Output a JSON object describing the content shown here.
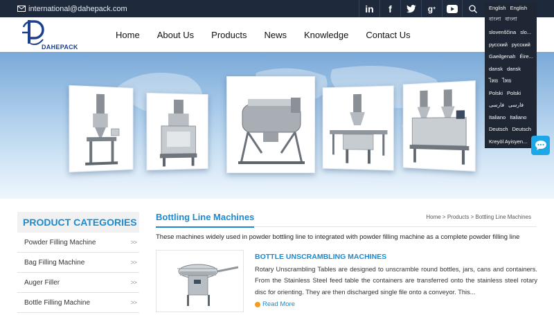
{
  "topbar": {
    "email": "international@dahepack.com",
    "social": [
      "linkedin-icon",
      "facebook-icon",
      "twitter-icon",
      "google-plus-icon",
      "youtube-icon"
    ]
  },
  "logo": {
    "text": "DAHEPACK"
  },
  "nav": {
    "items": [
      "Home",
      "About Us",
      "Products",
      "News",
      "Knowledge",
      "Contact Us"
    ]
  },
  "languages": [
    {
      "native": "English",
      "label": "English"
    },
    {
      "native": "বাংলা",
      "label": "বাংলা"
    },
    {
      "native": "slovenščina",
      "label": "slo..."
    },
    {
      "native": "русский",
      "label": "русский"
    },
    {
      "native": "Gaeilgenah",
      "label": "Éire..."
    },
    {
      "native": "dansk",
      "label": "dansk"
    },
    {
      "native": "ไทย",
      "label": "ไทย"
    },
    {
      "native": "Polski",
      "label": "Polski"
    },
    {
      "native": "فارسی",
      "label": "فارسی"
    },
    {
      "native": "Italiano",
      "label": "Italiano"
    },
    {
      "native": "Deutsch",
      "label": "Deutsch"
    },
    {
      "native": "Kreyòl Ayisyen...",
      "label": ""
    }
  ],
  "sidebar": {
    "heading": "PRODUCT CATEGORIES",
    "categories": [
      "Powder Filling Machine",
      "Bag Filling Machine",
      "Auger Filler",
      "Bottle Filling Machine"
    ]
  },
  "main": {
    "title": "Bottling Line Machines",
    "breadcrumb": "Home > Products > Bottling Line Machines",
    "intro": "These machines widely used in powder bottling line to integrated with powder filling machine as a complete powder filling line",
    "product": {
      "title": "BOTTLE UNSCRAMBLING MACHINES",
      "description": "Rotary Unscrambling Tables are designed to unscramble round bottles, jars, cans and containers. From the Stainless Steel feed table the containers are transferred onto the stainless steel rotary disc for orienting. They are then discharged single file onto a conveyor. This...",
      "read_more": "Read More"
    }
  },
  "colors": {
    "accent": "#1a8bd0",
    "topbar": "#1e2a3c",
    "dropdown": "#1f2734",
    "chat": "#1ea7e6"
  }
}
